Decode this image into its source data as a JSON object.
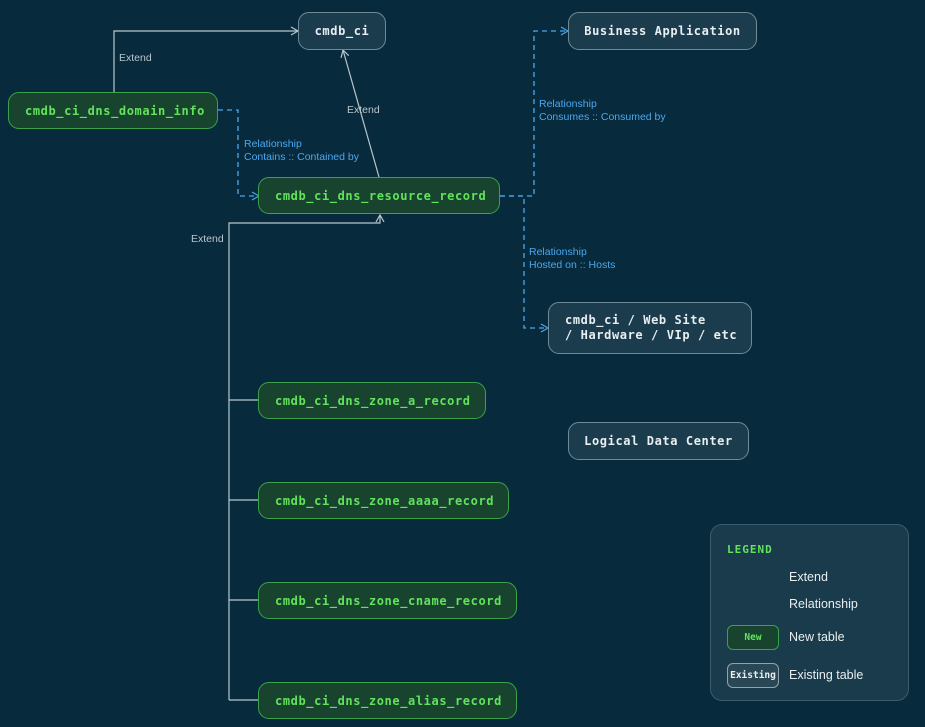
{
  "nodes": {
    "cmdb_ci": "cmdb_ci",
    "business_application": "Business Application",
    "dns_domain_info": "cmdb_ci_dns_domain_info",
    "dns_resource_record": "cmdb_ci_dns_resource_record",
    "web_site_line1": "cmdb_ci / Web Site",
    "web_site_line2": "/ Hardware / VIp / etc",
    "zone_a_record": "cmdb_ci_dns_zone_a_record",
    "logical_data_center": "Logical Data Center",
    "zone_aaaa_record": "cmdb_ci_dns_zone_aaaa_record",
    "zone_cname_record": "cmdb_ci_dns_zone_cname_record",
    "zone_alias_record": "cmdb_ci_dns_zone_alias_record"
  },
  "edge_labels": {
    "extend_domain": "Extend",
    "extend_resource": "Extend",
    "extend_zone": "Extend",
    "rel_contains_title": "Relationship",
    "rel_contains_desc": "Contains :: Contained by",
    "rel_consumes_title": "Relationship",
    "rel_consumes_desc": "Consumes :: Consumed by",
    "rel_hosted_title": "Relationship",
    "rel_hosted_desc": "Hosted on :: Hosts"
  },
  "legend": {
    "title": "LEGEND",
    "extend": "Extend",
    "relationship": "Relationship",
    "new_chip": "New",
    "new_table": "New table",
    "existing_chip": "Existing",
    "existing_table": "Existing table"
  },
  "colors": {
    "background": "#082a3d",
    "new_fill": "#17432f",
    "new_border": "#3aa24a",
    "new_text": "#62e45a",
    "existing_fill": "#1b3c4d",
    "existing_border": "#6f8b98",
    "extend_line": "#b9c6cc",
    "relationship_line": "#4aa8ee"
  }
}
